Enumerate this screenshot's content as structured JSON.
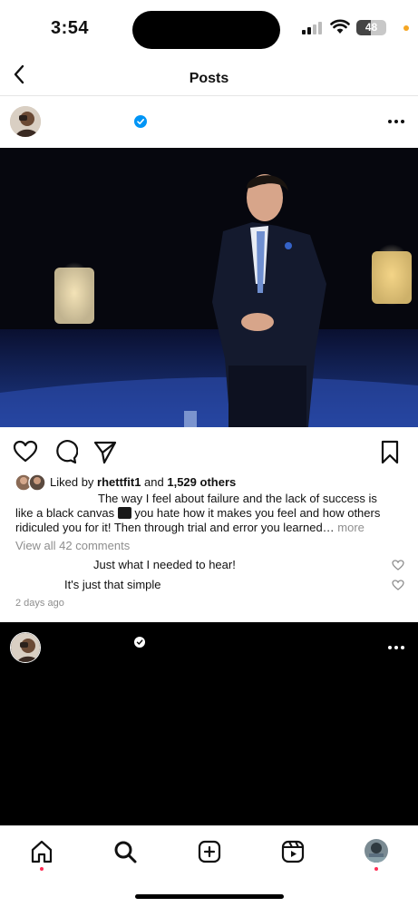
{
  "status_bar": {
    "time": "3:54",
    "battery_text": "48",
    "battery_level": 0.48
  },
  "header": {
    "title": "Posts"
  },
  "post1": {
    "likes": {
      "prefix": "Liked by ",
      "user": "rhettfit1",
      "middle": " and ",
      "count": "1,529 others"
    },
    "caption": {
      "line1": "The way I feel about failure and the lack of success is",
      "line2a": "like a black canvas ",
      "line2b": " you hate how it makes you feel and how others",
      "line3a": "ridiculed you for it! Then through trial and error you learned… ",
      "more": "more"
    },
    "view_all": "View all 42 comments",
    "comments": [
      {
        "text": "Just what I needed to hear!"
      },
      {
        "text": "It's just that simple"
      }
    ],
    "time_ago": "2 days ago"
  },
  "colors": {
    "verified": "#0095f6",
    "notify_dot": "#ff2d55",
    "muted": "#8e8e8e"
  }
}
